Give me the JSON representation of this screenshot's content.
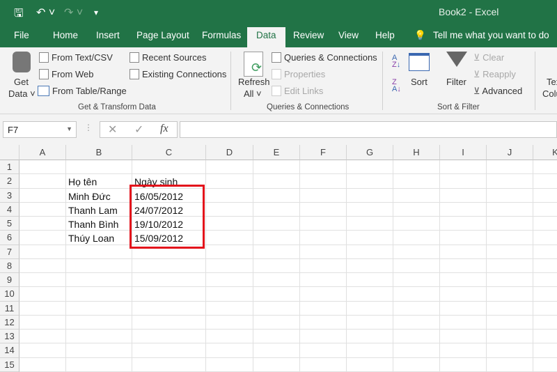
{
  "title": "Book2  -  Excel",
  "tabs": [
    "File",
    "Home",
    "Insert",
    "Page Layout",
    "Formulas",
    "Data",
    "Review",
    "View",
    "Help"
  ],
  "tell_me": "Tell me what you want to do",
  "ribbon": {
    "get_data": [
      "Get",
      "Data ˅"
    ],
    "from_text": "From Text/CSV",
    "from_web": "From Web",
    "from_table": "From Table/Range",
    "recent": "Recent Sources",
    "existing": "Existing Connections",
    "group1": "Get & Transform Data",
    "refresh": [
      "Refresh",
      "All ˅"
    ],
    "queries": "Queries & Connections",
    "properties": "Properties",
    "edit_links": "Edit Links",
    "group2": "Queries & Connections",
    "sort": "Sort",
    "filter": "Filter",
    "clear": "Clear",
    "reapply": "Reapply",
    "advanced": "Advanced",
    "group3": "Sort & Filter",
    "text_to_cols": [
      "Tex",
      "Colu"
    ]
  },
  "namebox": "F7",
  "columns": [
    "A",
    "B",
    "C",
    "D",
    "E",
    "F",
    "G",
    "H",
    "I",
    "J",
    "K"
  ],
  "rows": [
    "1",
    "2",
    "3",
    "4",
    "5",
    "6",
    "7",
    "8",
    "9",
    "10",
    "11",
    "12",
    "13",
    "14",
    "15"
  ],
  "cells": {
    "header_name": "Họ tên",
    "header_date": "Ngày sinh",
    "data": [
      [
        "Minh Đức",
        "16/05/2012"
      ],
      [
        "Thanh Lam",
        "24/07/2012"
      ],
      [
        "Thanh Bình",
        "19/10/2012"
      ],
      [
        "Thúy Loan",
        "15/09/2012"
      ]
    ]
  },
  "highlight_color": "#e3121b"
}
